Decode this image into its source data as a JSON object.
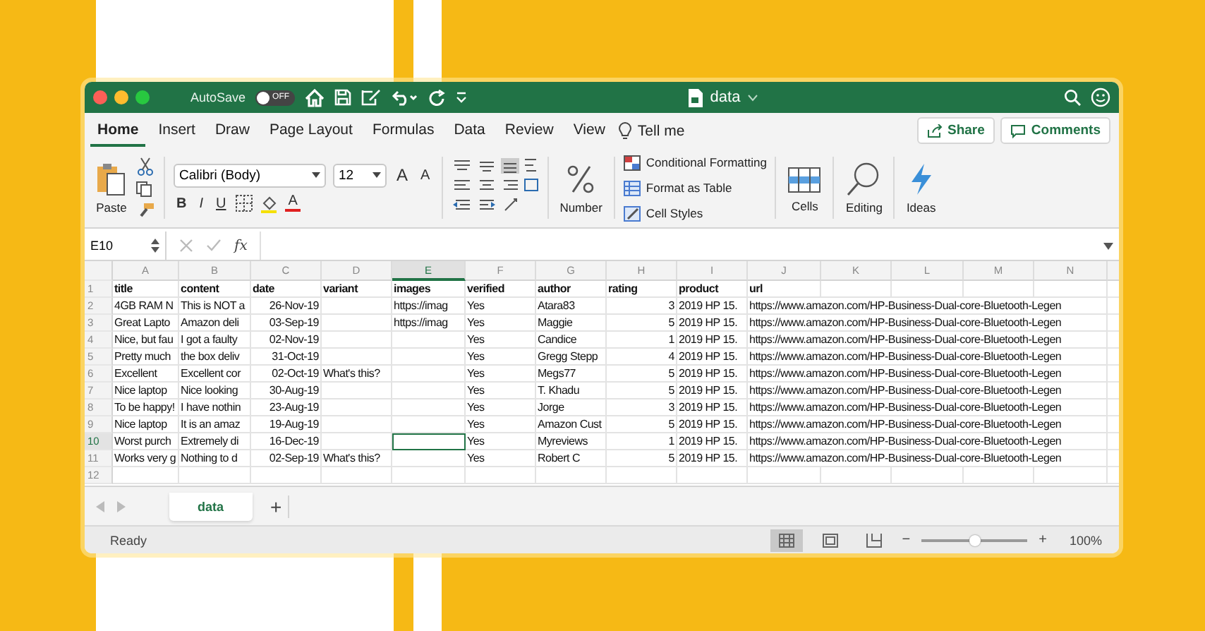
{
  "window": {
    "title": "data",
    "autosave_label": "AutoSave",
    "autosave_on": false,
    "autosave_state": "OFF"
  },
  "tabs": [
    {
      "label": "Home",
      "selected": true
    },
    {
      "label": "Insert",
      "selected": false
    },
    {
      "label": "Draw",
      "selected": false
    },
    {
      "label": "Page Layout",
      "selected": false
    },
    {
      "label": "Formulas",
      "selected": false
    },
    {
      "label": "Data",
      "selected": false
    },
    {
      "label": "Review",
      "selected": false
    },
    {
      "label": "View",
      "selected": false
    }
  ],
  "tell_me": "Tell me",
  "share_label": "Share",
  "comments_label": "Comments",
  "ribbon": {
    "paste_label": "Paste",
    "font_name": "Calibri (Body)",
    "font_size": "12",
    "grow_font": "A",
    "shrink_font": "A",
    "bold": "B",
    "italic": "I",
    "underline": "U",
    "font_color": "A",
    "number_label": "Number",
    "conditional_formatting": "Conditional Formatting",
    "format_as_table": "Format as Table",
    "cell_styles": "Cell Styles",
    "cells_label": "Cells",
    "editing_label": "Editing",
    "ideas_label": "Ideas"
  },
  "formula_bar": {
    "name_box": "E10",
    "fx": "fx"
  },
  "columns": [
    {
      "letter": "A",
      "selected": false
    },
    {
      "letter": "B",
      "selected": false
    },
    {
      "letter": "C",
      "selected": false
    },
    {
      "letter": "D",
      "selected": false
    },
    {
      "letter": "E",
      "selected": true
    },
    {
      "letter": "F",
      "selected": false
    },
    {
      "letter": "G",
      "selected": false
    },
    {
      "letter": "H",
      "selected": false
    },
    {
      "letter": "I",
      "selected": false
    },
    {
      "letter": "J",
      "selected": false
    },
    {
      "letter": "K",
      "selected": false
    },
    {
      "letter": "L",
      "selected": false
    },
    {
      "letter": "M",
      "selected": false
    },
    {
      "letter": "N",
      "selected": false
    }
  ],
  "rows": [
    {
      "number": "1",
      "selected": false,
      "cells": [
        "title",
        "content",
        "date",
        "variant",
        "images",
        "verified",
        "author",
        "rating",
        "product",
        "url"
      ]
    },
    {
      "number": "2",
      "selected": false,
      "cells": [
        "4GB RAM N",
        "This is NOT a",
        "26-Nov-19",
        "",
        "https://imag",
        "Yes",
        "Atara83",
        "3",
        "2019 HP 15.",
        "https://www.amazon.com/HP-Business-Dual-core-Bluetooth-Legen"
      ]
    },
    {
      "number": "3",
      "selected": false,
      "cells": [
        "Great Lapto",
        "Amazon deli",
        "03-Sep-19",
        "",
        "https://imag",
        "Yes",
        "Maggie",
        "5",
        "2019 HP 15.",
        "https://www.amazon.com/HP-Business-Dual-core-Bluetooth-Legen"
      ]
    },
    {
      "number": "4",
      "selected": false,
      "cells": [
        "Nice, but fau",
        "I got a faulty",
        "02-Nov-19",
        "",
        "",
        "Yes",
        "Candice",
        "1",
        "2019 HP 15.",
        "https://www.amazon.com/HP-Business-Dual-core-Bluetooth-Legen"
      ]
    },
    {
      "number": "5",
      "selected": false,
      "cells": [
        "Pretty much",
        "the box deliv",
        "31-Oct-19",
        "",
        "",
        "Yes",
        "Gregg Stepp",
        "4",
        "2019 HP 15.",
        "https://www.amazon.com/HP-Business-Dual-core-Bluetooth-Legen"
      ]
    },
    {
      "number": "6",
      "selected": false,
      "cells": [
        "Excellent",
        "Excellent cor",
        "02-Oct-19",
        "What's this?",
        "",
        "Yes",
        "Megs77",
        "5",
        "2019 HP 15.",
        "https://www.amazon.com/HP-Business-Dual-core-Bluetooth-Legen"
      ]
    },
    {
      "number": "7",
      "selected": false,
      "cells": [
        "Nice laptop",
        "Nice looking",
        "30-Aug-19",
        "",
        "",
        "Yes",
        "T. Khadu",
        "5",
        "2019 HP 15.",
        "https://www.amazon.com/HP-Business-Dual-core-Bluetooth-Legen"
      ]
    },
    {
      "number": "8",
      "selected": false,
      "cells": [
        "To be happy!",
        "I have nothin",
        "23-Aug-19",
        "",
        "",
        "Yes",
        "Jorge",
        "3",
        "2019 HP 15.",
        "https://www.amazon.com/HP-Business-Dual-core-Bluetooth-Legen"
      ]
    },
    {
      "number": "9",
      "selected": false,
      "cells": [
        "Nice laptop",
        "It is an amaz",
        "19-Aug-19",
        "",
        "",
        "Yes",
        "Amazon Cust",
        "5",
        "2019 HP 15.",
        "https://www.amazon.com/HP-Business-Dual-core-Bluetooth-Legen"
      ]
    },
    {
      "number": "10",
      "selected": true,
      "cells": [
        "Worst purch",
        "Extremely di",
        "16-Dec-19",
        "",
        "",
        "Yes",
        "Myreviews",
        "1",
        "2019 HP 15.",
        "https://www.amazon.com/HP-Business-Dual-core-Bluetooth-Legen"
      ]
    },
    {
      "number": "11",
      "selected": false,
      "cells": [
        "Works very g",
        "Nothing to d",
        "02-Sep-19",
        "What's this?",
        "",
        "Yes",
        "Robert C",
        "5",
        "2019 HP 15.",
        "https://www.amazon.com/HP-Business-Dual-core-Bluetooth-Legen"
      ]
    },
    {
      "number": "12",
      "selected": false,
      "cells": []
    }
  ],
  "sheet_tabs": [
    {
      "label": "data",
      "selected": true
    }
  ],
  "add_sheet": "+",
  "status_bar": {
    "status": "Ready",
    "views": [
      {
        "kind": "normal",
        "selected": true
      },
      {
        "kind": "page-layout",
        "selected": false
      },
      {
        "kind": "page-break",
        "selected": false
      }
    ],
    "zoom_minus": "−",
    "zoom_plus": "+",
    "zoom": {
      "level": 0.5
    },
    "zoom_label": "100%"
  }
}
